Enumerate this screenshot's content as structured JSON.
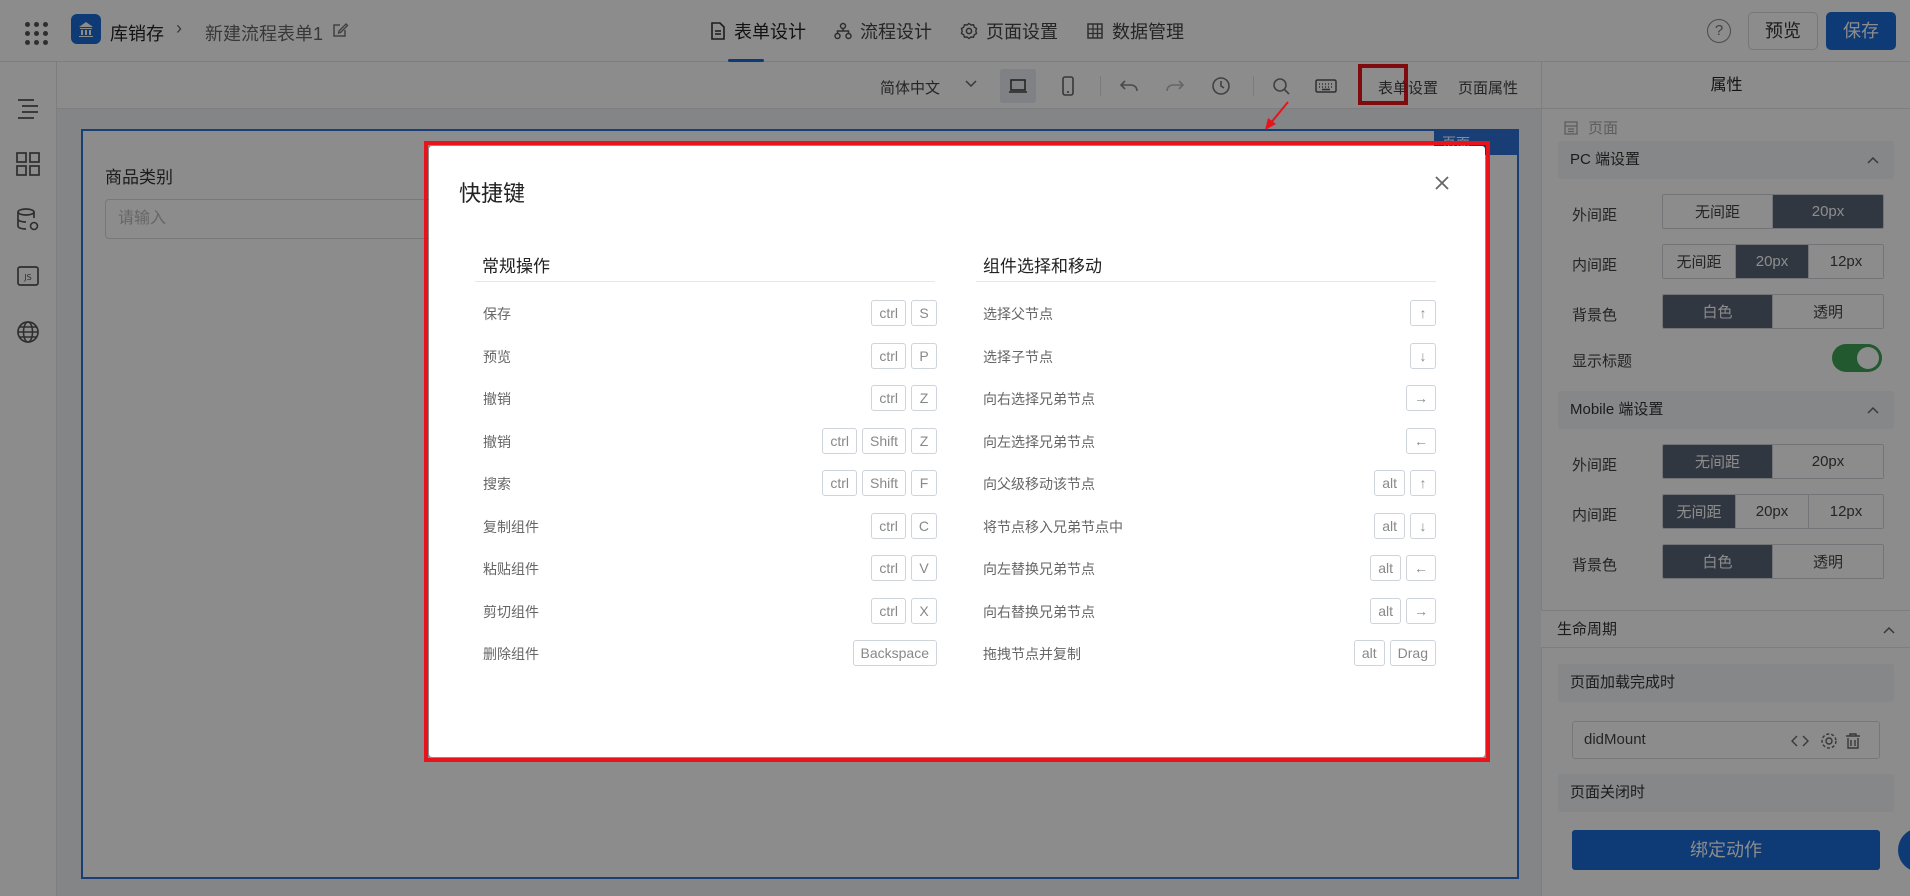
{
  "header": {
    "app_name": "库销存",
    "crumb_separator": "›",
    "form_name": "新建流程表单1",
    "tabs": [
      {
        "label": "表单设计"
      },
      {
        "label": "流程设计"
      },
      {
        "label": "页面设置"
      },
      {
        "label": "数据管理"
      }
    ],
    "help_label": "?",
    "preview_label": "预览",
    "save_label": "保存"
  },
  "toolbar": {
    "language": "简体中文",
    "form_settings": "表单设置",
    "page_properties": "页面属性"
  },
  "canvas": {
    "page_tag": "页面",
    "field_label": "商品类别",
    "field_placeholder": "请输入"
  },
  "right_panel": {
    "title": "属性",
    "page_label": "页面",
    "pc_section": "PC 端设置",
    "mobile_section": "Mobile 端设置",
    "labels": {
      "margin": "外间距",
      "padding": "内间距",
      "background": "背景色",
      "show_title": "显示标题"
    },
    "pc_margin_options": [
      "无间距",
      "20px"
    ],
    "pc_padding_options": [
      "无间距",
      "20px",
      "12px"
    ],
    "pc_bg_options": [
      "白色",
      "透明"
    ],
    "mobile_margin_options": [
      "无间距",
      "20px"
    ],
    "mobile_padding_options": [
      "无间距",
      "20px",
      "12px"
    ],
    "mobile_bg_options": [
      "白色",
      "透明"
    ],
    "lifecycle": "生命周期",
    "on_load": "页面加载完成时",
    "method": "didMount",
    "on_close": "页面关闭时",
    "bind_action": "绑定动作"
  },
  "modal": {
    "title": "快捷键",
    "left_title": "常规操作",
    "right_title": "组件选择和移动",
    "left": [
      {
        "label": "保存",
        "keys": [
          "ctrl",
          "S"
        ]
      },
      {
        "label": "预览",
        "keys": [
          "ctrl",
          "P"
        ]
      },
      {
        "label": "撤销",
        "keys": [
          "ctrl",
          "Z"
        ]
      },
      {
        "label": "撤销",
        "keys": [
          "ctrl",
          "Shift",
          "Z"
        ]
      },
      {
        "label": "搜索",
        "keys": [
          "ctrl",
          "Shift",
          "F"
        ]
      },
      {
        "label": "复制组件",
        "keys": [
          "ctrl",
          "C"
        ]
      },
      {
        "label": "粘贴组件",
        "keys": [
          "ctrl",
          "V"
        ]
      },
      {
        "label": "剪切组件",
        "keys": [
          "ctrl",
          "X"
        ]
      },
      {
        "label": "删除组件",
        "keys": [
          "Backspace"
        ]
      }
    ],
    "right": [
      {
        "label": "选择父节点",
        "keys": [
          "↑"
        ]
      },
      {
        "label": "选择子节点",
        "keys": [
          "↓"
        ]
      },
      {
        "label": "向右选择兄弟节点",
        "keys": [
          "→"
        ]
      },
      {
        "label": "向左选择兄弟节点",
        "keys": [
          "←"
        ]
      },
      {
        "label": "向父级移动该节点",
        "keys": [
          "alt",
          "↑"
        ]
      },
      {
        "label": "将节点移入兄弟节点中",
        "keys": [
          "alt",
          "↓"
        ]
      },
      {
        "label": "向左替换兄弟节点",
        "keys": [
          "alt",
          "←"
        ]
      },
      {
        "label": "向右替换兄弟节点",
        "keys": [
          "alt",
          "→"
        ]
      },
      {
        "label": "拖拽节点并复制",
        "keys": [
          "alt",
          "Drag"
        ]
      }
    ]
  },
  "colors": {
    "brand": "#1b6bd6",
    "highlight": "#e8141c",
    "toggle_on": "#3fa256"
  }
}
